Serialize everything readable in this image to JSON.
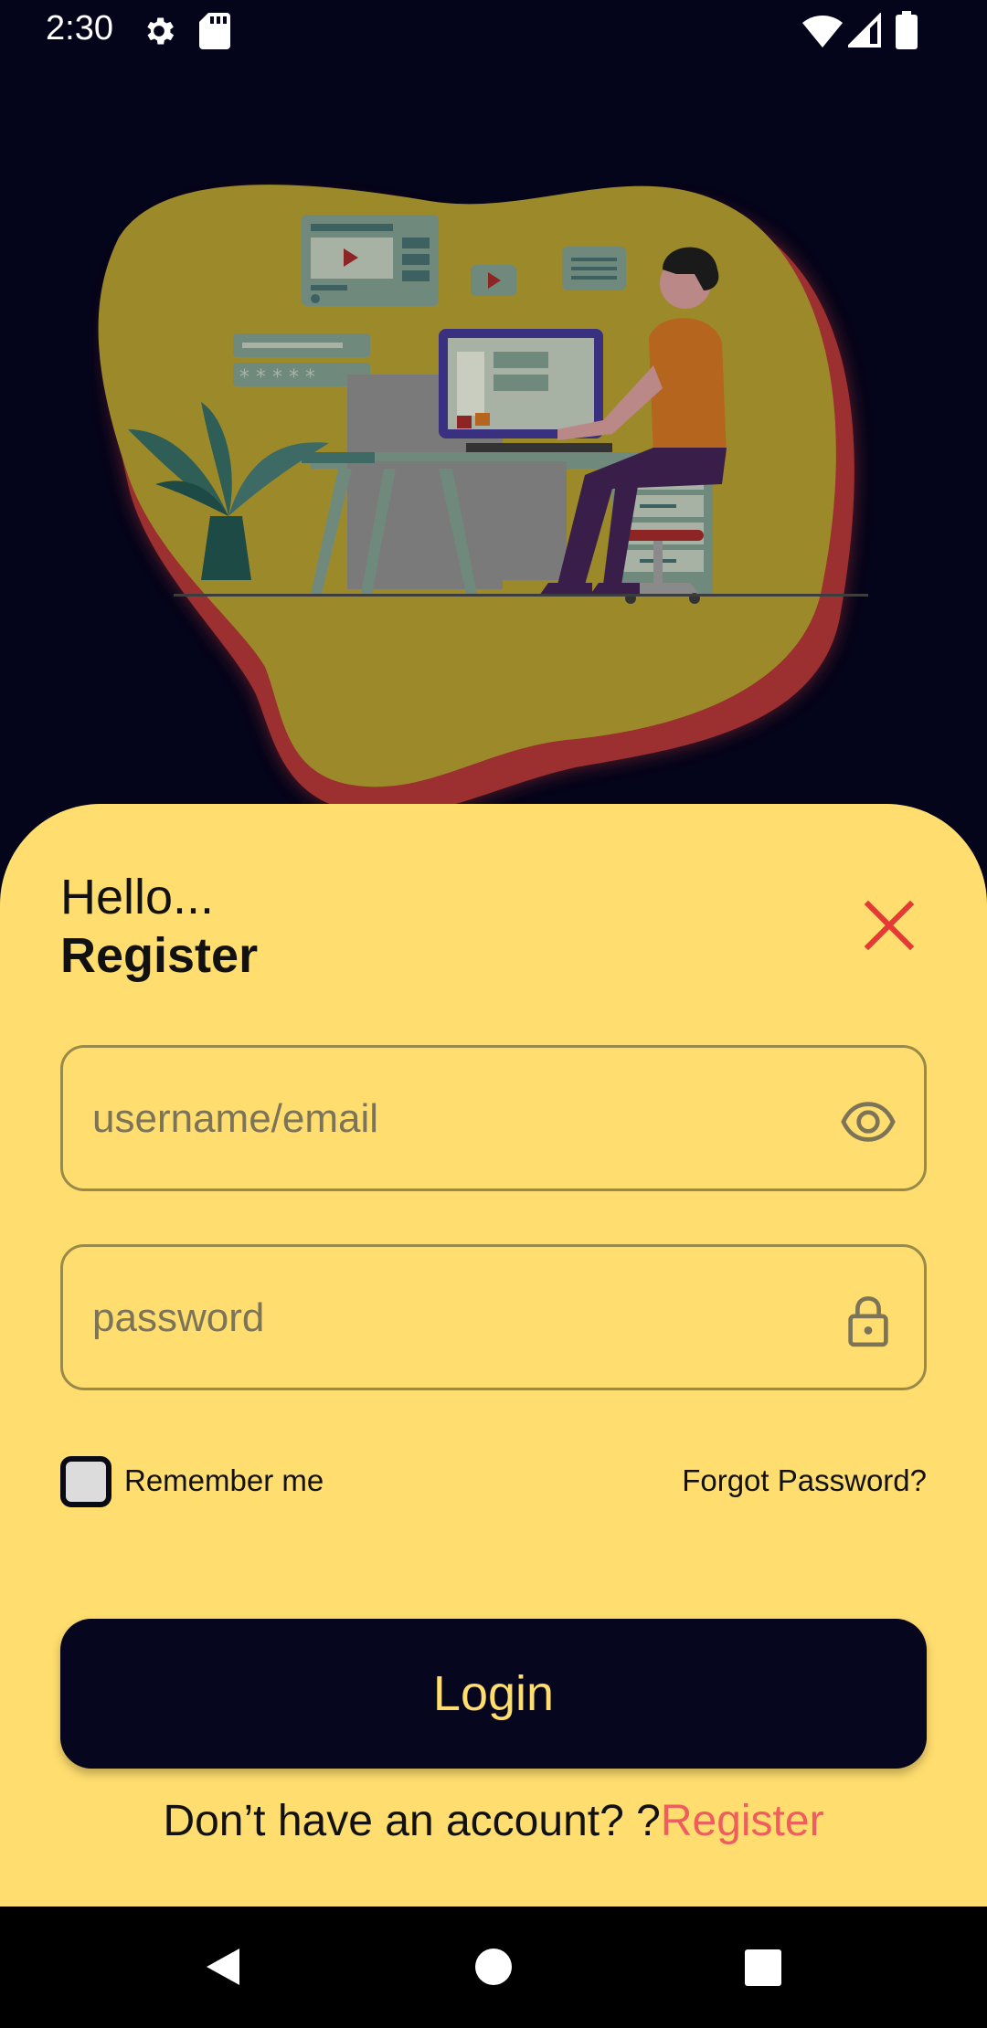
{
  "status_bar": {
    "time": "2:30",
    "icons": [
      "gear-icon",
      "sd-card-icon",
      "wifi-icon",
      "signal-icon",
      "battery-icon"
    ]
  },
  "illustration": {
    "subject": "person-at-desk-illustration"
  },
  "sheet": {
    "greeting": "Hello...",
    "title": "Register",
    "close_icon": "close-icon"
  },
  "form": {
    "username": {
      "placeholder": "username/email",
      "value": "",
      "icon": "eye-icon"
    },
    "password": {
      "placeholder": "password",
      "value": "",
      "icon": "lock-icon"
    },
    "remember_label": "Remember me",
    "remember_checked": false,
    "forgot_label": "Forgot Password?",
    "login_label": "Login",
    "signup_prompt": "Don’t have an account? ?",
    "signup_link": "Register"
  },
  "nav_bar": {
    "icons": [
      "back-icon",
      "home-icon",
      "recents-icon"
    ]
  },
  "colors": {
    "background": "#04041a",
    "sheet": "#ffdd6e",
    "button": "#06061f",
    "button_text": "#ffdd6e",
    "accent_red": "#ef5e5e",
    "close_red": "#e53935"
  }
}
